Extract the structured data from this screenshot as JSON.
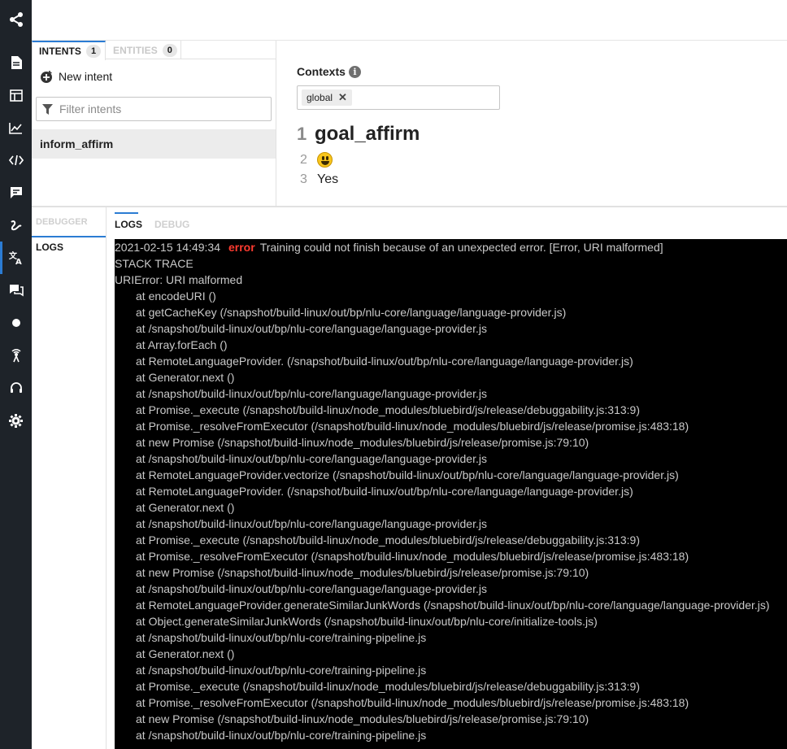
{
  "rail": {
    "icons": [
      "share-icon",
      "document-icon",
      "layout-icon",
      "chart-icon",
      "code-icon",
      "chat-icon",
      "flow-icon",
      "translate-icon",
      "conversation-icon",
      "dot-icon",
      "broadcast-icon",
      "headset-icon",
      "settings-icon"
    ],
    "active_index": 7
  },
  "intent_panel": {
    "tabs": [
      {
        "label": "INTENTS",
        "count": "1"
      },
      {
        "label": "ENTITIES",
        "count": "0"
      }
    ],
    "new_intent_label": "New intent",
    "filter_placeholder": "Filter intents",
    "intents": [
      "inform_affirm"
    ]
  },
  "editor": {
    "contexts_label": "Contexts",
    "context_tag": "global",
    "lines": [
      {
        "num": "1",
        "text": "goal_affirm"
      },
      {
        "num": "2",
        "text": ""
      },
      {
        "num": "3",
        "text": "Yes"
      }
    ]
  },
  "debugger": {
    "side_title": "DEBUGGER",
    "side_item": "LOGS",
    "tabs": [
      "LOGS",
      "DEBUG"
    ]
  },
  "console": {
    "first_line": {
      "timestamp": "2021-02-15 14:49:34",
      "level": "error",
      "message": "Training could not finish because of an unexpected error. [Error, URI malformed]"
    },
    "header_lines": [
      "STACK TRACE",
      "URIError: URI malformed"
    ],
    "stack": [
      "at encodeURI ()",
      "at getCacheKey (/snapshot/build-linux/out/bp/nlu-core/language/language-provider.js)",
      "at /snapshot/build-linux/out/bp/nlu-core/language/language-provider.js",
      "at Array.forEach ()",
      "at RemoteLanguageProvider. (/snapshot/build-linux/out/bp/nlu-core/language/language-provider.js)",
      "at Generator.next ()",
      "at /snapshot/build-linux/out/bp/nlu-core/language/language-provider.js",
      "at Promise._execute (/snapshot/build-linux/node_modules/bluebird/js/release/debuggability.js:313:9)",
      "at Promise._resolveFromExecutor (/snapshot/build-linux/node_modules/bluebird/js/release/promise.js:483:18)",
      "at new Promise (/snapshot/build-linux/node_modules/bluebird/js/release/promise.js:79:10)",
      "at /snapshot/build-linux/out/bp/nlu-core/language/language-provider.js",
      "at RemoteLanguageProvider.vectorize (/snapshot/build-linux/out/bp/nlu-core/language/language-provider.js)",
      "at RemoteLanguageProvider. (/snapshot/build-linux/out/bp/nlu-core/language/language-provider.js)",
      "at Generator.next ()",
      "at /snapshot/build-linux/out/bp/nlu-core/language/language-provider.js",
      "at Promise._execute (/snapshot/build-linux/node_modules/bluebird/js/release/debuggability.js:313:9)",
      "at Promise._resolveFromExecutor (/snapshot/build-linux/node_modules/bluebird/js/release/promise.js:483:18)",
      "at new Promise (/snapshot/build-linux/node_modules/bluebird/js/release/promise.js:79:10)",
      "at /snapshot/build-linux/out/bp/nlu-core/language/language-provider.js",
      "at RemoteLanguageProvider.generateSimilarJunkWords (/snapshot/build-linux/out/bp/nlu-core/language/language-provider.js)",
      "at Object.generateSimilarJunkWords (/snapshot/build-linux/out/bp/nlu-core/initialize-tools.js)",
      "at /snapshot/build-linux/out/bp/nlu-core/training-pipeline.js",
      "at Generator.next ()",
      "at /snapshot/build-linux/out/bp/nlu-core/training-pipeline.js",
      "at Promise._execute (/snapshot/build-linux/node_modules/bluebird/js/release/debuggability.js:313:9)",
      "at Promise._resolveFromExecutor (/snapshot/build-linux/node_modules/bluebird/js/release/promise.js:483:18)",
      "at new Promise (/snapshot/build-linux/node_modules/bluebird/js/release/promise.js:79:10)",
      "at /snapshot/build-linux/out/bp/nlu-core/training-pipeline.js"
    ]
  },
  "colors": {
    "rail_bg": "#1e2329",
    "accent": "#2b7cd3",
    "error": "#ff3b30",
    "console_bg": "#000000",
    "console_text": "#c9c9c9"
  }
}
